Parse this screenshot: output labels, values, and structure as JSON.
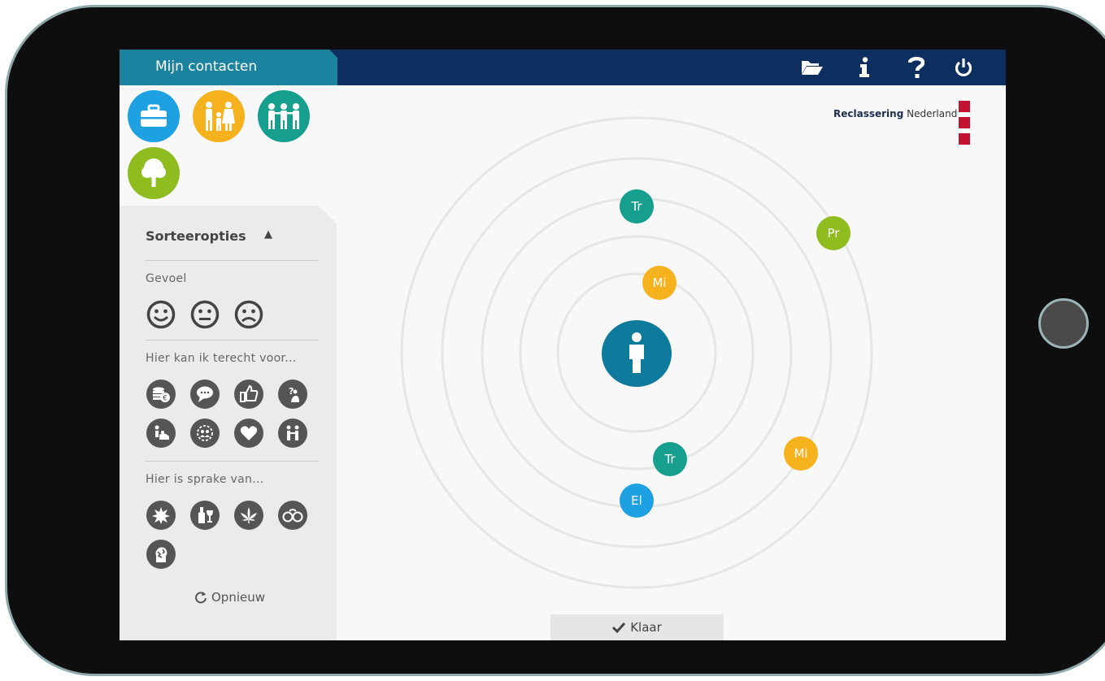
{
  "header": {
    "tab_title": "Mijn contacten"
  },
  "toolbar": {
    "icons": [
      "folder-open-icon",
      "info-icon",
      "help-icon",
      "power-icon"
    ]
  },
  "categories": [
    {
      "name": "work",
      "icon": "briefcase-icon",
      "color": "#1da1e2"
    },
    {
      "name": "family",
      "icon": "family-icon",
      "color": "#f5b21c"
    },
    {
      "name": "friends",
      "icon": "group-icon",
      "color": "#169e8e"
    },
    {
      "name": "leisure",
      "icon": "tree-icon",
      "color": "#8fbc1f"
    }
  ],
  "sort": {
    "title": "Sorteeropties",
    "feeling_label": "Gevoel",
    "feelings": [
      "happy-face-icon",
      "neutral-face-icon",
      "sad-face-icon"
    ],
    "help_label": "Hier kan ik terecht voor...",
    "help_icons": [
      "money-icon",
      "chat-icon",
      "thumbs-up-icon",
      "question-person-icon",
      "care-icon",
      "people-circle-icon",
      "heart-icon",
      "two-persons-icon"
    ],
    "issues_label": "Hier is sprake van...",
    "issue_icons": [
      "conflict-icon",
      "alcohol-icon",
      "cannabis-icon",
      "handcuffs-icon",
      "stress-icon"
    ],
    "reset_label": "Opnieuw"
  },
  "network": {
    "center_icon": "person-icon",
    "center_color": "#0e7a9c",
    "contacts": [
      {
        "label": "Tr",
        "color": "#169e8e"
      },
      {
        "label": "Pr",
        "color": "#8fbc1f"
      },
      {
        "label": "Mi",
        "color": "#f5b21c"
      },
      {
        "label": "Tr",
        "color": "#169e8e"
      },
      {
        "label": "Mi",
        "color": "#f5b21c"
      },
      {
        "label": "El",
        "color": "#1da1e2"
      }
    ]
  },
  "footer": {
    "done_label": "Klaar"
  },
  "brand": {
    "bold": "Reclassering",
    "rest": "Nederland",
    "color": "#c41231"
  }
}
